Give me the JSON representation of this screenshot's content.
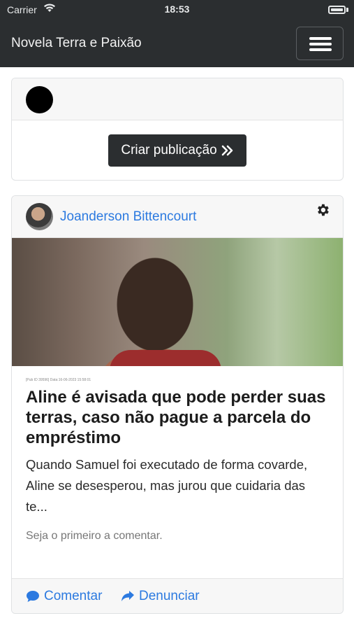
{
  "status_bar": {
    "carrier": "Carrier",
    "time": "18:53"
  },
  "navbar": {
    "brand": "Novela Terra e Paixão",
    "menu_icon": "hamburger-menu-icon"
  },
  "composer": {
    "create_label": "Criar publicação",
    "create_icon": "double-chevron-right-icon"
  },
  "post": {
    "author": "Joanderson Bittencourt",
    "settings_icon": "gear-icon",
    "meta": "[Pub ID 39596] Data:16-06-2023 15:58:01",
    "title": "Aline é avisada que pode perder suas terras, caso não pague a parcela do empréstimo",
    "excerpt": "Quando Samuel  foi executado de forma covarde, Aline  se desesperou, mas jurou que cuidaria das te...",
    "comments_text": "Seja o primeiro a comentar.",
    "actions": {
      "comment": "Comentar",
      "report": "Denunciar"
    }
  },
  "colors": {
    "navbar_bg": "#2b2e30",
    "link_blue": "#2c7ae0",
    "card_header_bg": "#f7f7f7"
  }
}
